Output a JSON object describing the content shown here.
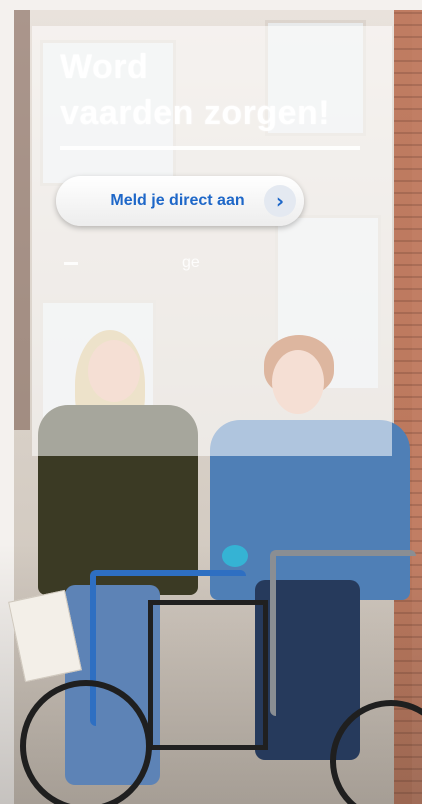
{
  "hero": {
    "headline_line1": "Word",
    "headline_line2": "vaarden zorgen!",
    "cta_label": "Meld je direct aan",
    "cta_icon": "chevron-right-icon",
    "faint_text": "ge"
  },
  "colors": {
    "accent": "#1e67c8",
    "button_bg": "#ffffff",
    "bell": "#35b3d4"
  }
}
